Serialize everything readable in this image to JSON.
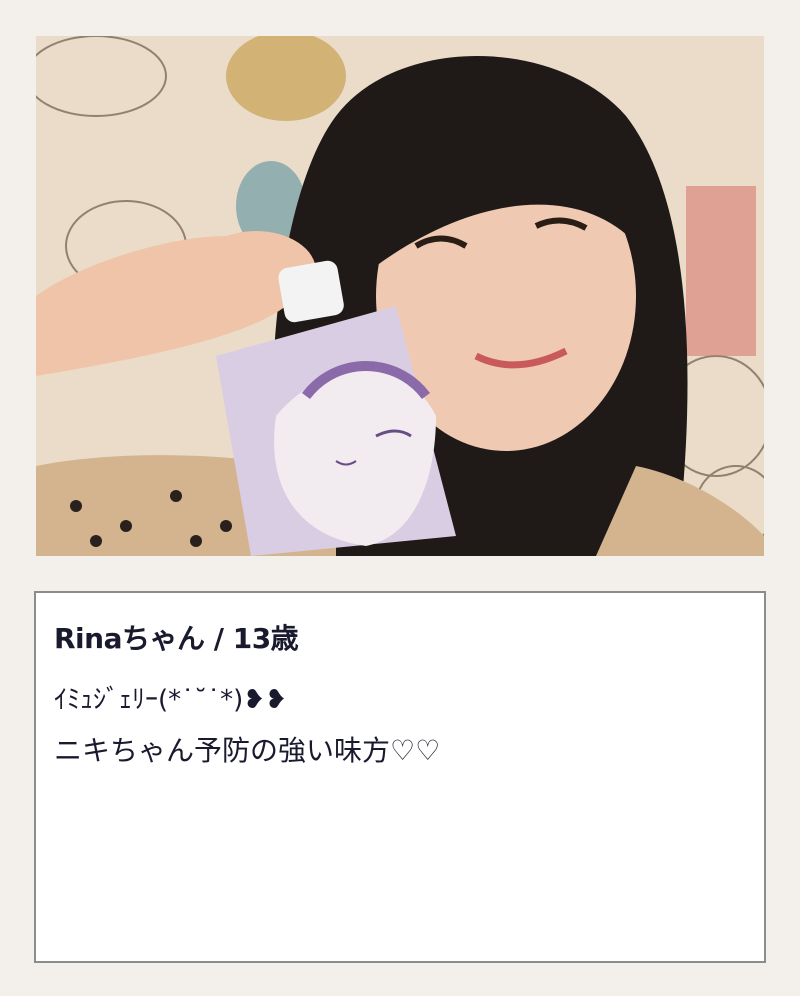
{
  "card": {
    "title": "Rinaちゃん / 13歳",
    "line1": "ｲﾐｭｼﾞｪﾘｰ(*˙˘˙*)❥❥",
    "line2": "ニキちゃん予防の強い味方♡♡"
  }
}
